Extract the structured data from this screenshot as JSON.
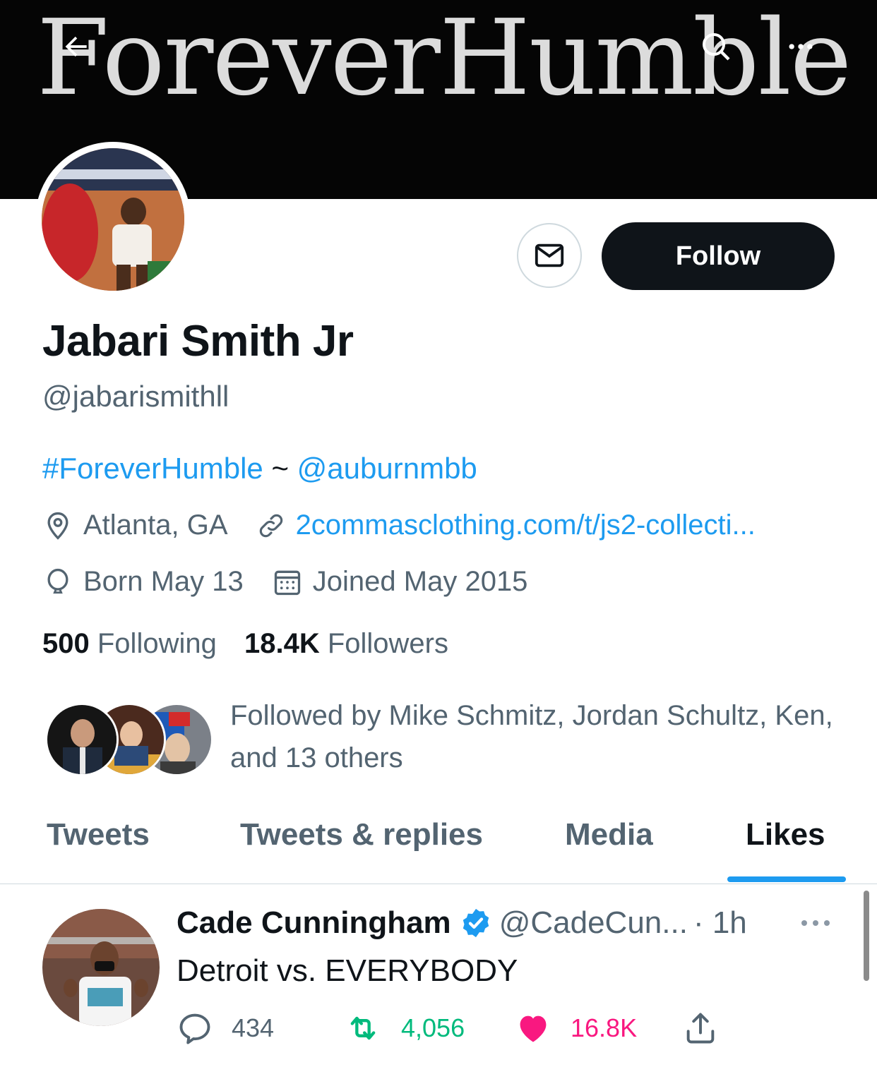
{
  "banner": {
    "text": "ForeverHumble"
  },
  "profile": {
    "name": "Jabari Smith Jr",
    "handle": "@jabarismithll",
    "follow_label": "Follow",
    "bio": {
      "hashtag": "#ForeverHumble",
      "separator": " ~ ",
      "mention": "@auburnmbb"
    },
    "location": "Atlanta, GA",
    "website": "2commasclothing.com/t/js2-collecti...",
    "birthday": "Born May 13",
    "joined": "Joined May 2015",
    "following_count": "500",
    "following_label": "Following",
    "followers_count": "18.4K",
    "followers_label": "Followers",
    "followed_by": "Followed by Mike Schmitz, Jordan Schultz, Ken, and 13 others"
  },
  "tabs": [
    {
      "label": "Tweets",
      "active": false
    },
    {
      "label": "Tweets & replies",
      "active": false
    },
    {
      "label": "Media",
      "active": false
    },
    {
      "label": "Likes",
      "active": true
    }
  ],
  "tweet": {
    "name": "Cade Cunningham",
    "handle": "@CadeCun...",
    "time": "· 1h",
    "text": "Detroit vs. EVERYBODY",
    "replies": "434",
    "retweets": "4,056",
    "likes": "16.8K"
  },
  "colors": {
    "accent": "#1d9bf0",
    "retweet": "#00ba7c",
    "like": "#f91880",
    "verified": "#1d9bf0"
  },
  "icons": [
    "back-arrow-icon",
    "search-icon",
    "more-icon",
    "mail-icon",
    "location-icon",
    "link-icon",
    "balloon-icon",
    "calendar-icon",
    "verified-icon",
    "reply-icon",
    "retweet-icon",
    "heart-icon",
    "share-icon"
  ]
}
